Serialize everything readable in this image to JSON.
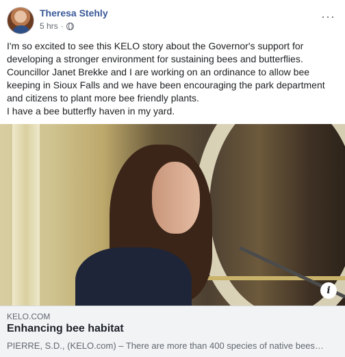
{
  "post": {
    "author": "Theresa Stehly",
    "timestamp": "5 hrs",
    "separator": "·",
    "privacy_icon": "globe-icon",
    "more_icon": "more-options-icon",
    "text_lines": [
      "I'm so excited to see this KELO story about the Governor's support for",
      "developing a stronger environment for sustaining bees and butterflies.",
      "Councillor Janet Brekke and I are working on an ordinance to allow bee",
      "keeping in Sioux Falls and we have been encouraging the park department",
      "and citizens to plant more bee friendly plants.",
      "I have a bee butterfly haven in my yard."
    ]
  },
  "link_preview": {
    "domain": "KELO.COM",
    "title": "Enhancing bee habitat",
    "description": "PIERRE, S.D., (KELO.com) – There are more than 400 species of native bees…",
    "info_icon": "info-icon"
  },
  "colors": {
    "author_link": "#385898",
    "meta_text": "#606770",
    "link_box_bg": "#f2f3f5"
  }
}
